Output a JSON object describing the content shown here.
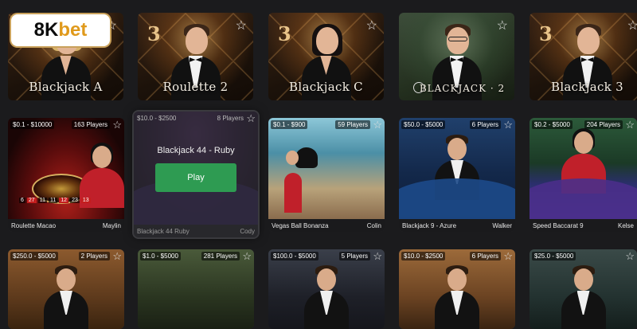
{
  "brand": {
    "name_main": "8K",
    "name_accent": "bet"
  },
  "top_tables": [
    {
      "name": "Blackjack A"
    },
    {
      "name": "Roulette 2",
      "logo": "3"
    },
    {
      "name": "Blackjack C",
      "logo": "3"
    },
    {
      "name": "BLACKJACK · 2"
    },
    {
      "name": "Blackjack 3",
      "logo": "3"
    }
  ],
  "grid_row1": [
    {
      "limit": "$0.1 - $10000",
      "players": "163 Players",
      "name": "Roulette Macao",
      "dealer": "Maylin",
      "results": [
        "6",
        "27",
        "11",
        "11",
        "12",
        "23",
        "13"
      ],
      "red_results": [
        "27",
        "12",
        "13"
      ]
    },
    {
      "limit": "$10.0 - $2500",
      "players": "8 Players",
      "name": "Blackjack 44 Ruby",
      "dealer": "Cody",
      "hover_title": "Blackjack 44 - Ruby",
      "play_label": "Play"
    },
    {
      "limit": "$0.1 - $900",
      "players": "59 Players",
      "name": "Vegas Ball Bonanza",
      "dealer": "Colin"
    },
    {
      "limit": "$50.0 - $5000",
      "players": "6 Players",
      "name": "Blackjack 9 - Azure",
      "dealer": "Walker"
    },
    {
      "limit": "$0.2 - $5000",
      "players": "204 Players",
      "name": "Speed Baccarat 9",
      "dealer": "Kelse"
    }
  ],
  "grid_row2": [
    {
      "limit": "$250.0 - $5000",
      "players": "2 Players"
    },
    {
      "limit": "$1.0 - $5000",
      "players": "281 Players"
    },
    {
      "limit": "$100.0 - $5000",
      "players": "5 Players"
    },
    {
      "limit": "$10.0 - $2500",
      "players": "6 Players"
    },
    {
      "limit": "$25.0 - $5000",
      "players": ""
    }
  ],
  "icons": {
    "favorite": "star-icon"
  }
}
